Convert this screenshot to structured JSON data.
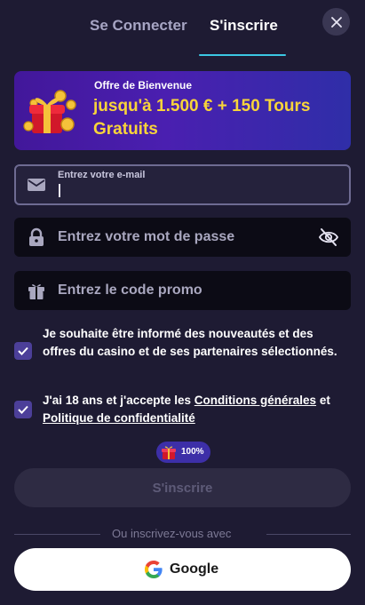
{
  "tabs": {
    "login": "Se Connecter",
    "register": "S'inscrire",
    "active": "register"
  },
  "close": {
    "icon": "close-icon"
  },
  "banner": {
    "subtitle": "Offre de Bienvenue",
    "title": "jusqu'à 1.500 € + 150 Tours Gratuits",
    "icon": "gift-box-icon",
    "title_color": "#f8d43a"
  },
  "form": {
    "email": {
      "label": "Entrez votre e-mail",
      "value": "",
      "icon": "envelope-icon"
    },
    "password": {
      "placeholder": "Entrez votre mot de passe",
      "icon": "lock-icon",
      "toggle_icon": "eye-off-icon"
    },
    "promo": {
      "placeholder": "Entrez le code promo",
      "icon": "gift-icon"
    }
  },
  "consents": {
    "newsletter": {
      "checked": true,
      "text": "Je souhaite être informé des nouveautés et des offres du casino et de ses partenaires sélectionnés."
    },
    "terms": {
      "checked": true,
      "prefix": "J'ai 18 ans et j'accepte les ",
      "terms_link": "Conditions générales",
      "middle": " et ",
      "privacy_link": "Politique de confidentialité"
    }
  },
  "progress": {
    "value": "100%",
    "icon": "gift-icon"
  },
  "submit": {
    "label": "S'inscrire",
    "enabled": false
  },
  "divider": {
    "text": "Ou inscrivez-vous avec"
  },
  "social": {
    "google_label": "Google",
    "icon": "google-icon"
  },
  "colors": {
    "background": "#1e1b33",
    "accent_underline": "#3bc7e3",
    "checkbox": "#4c3f99"
  }
}
